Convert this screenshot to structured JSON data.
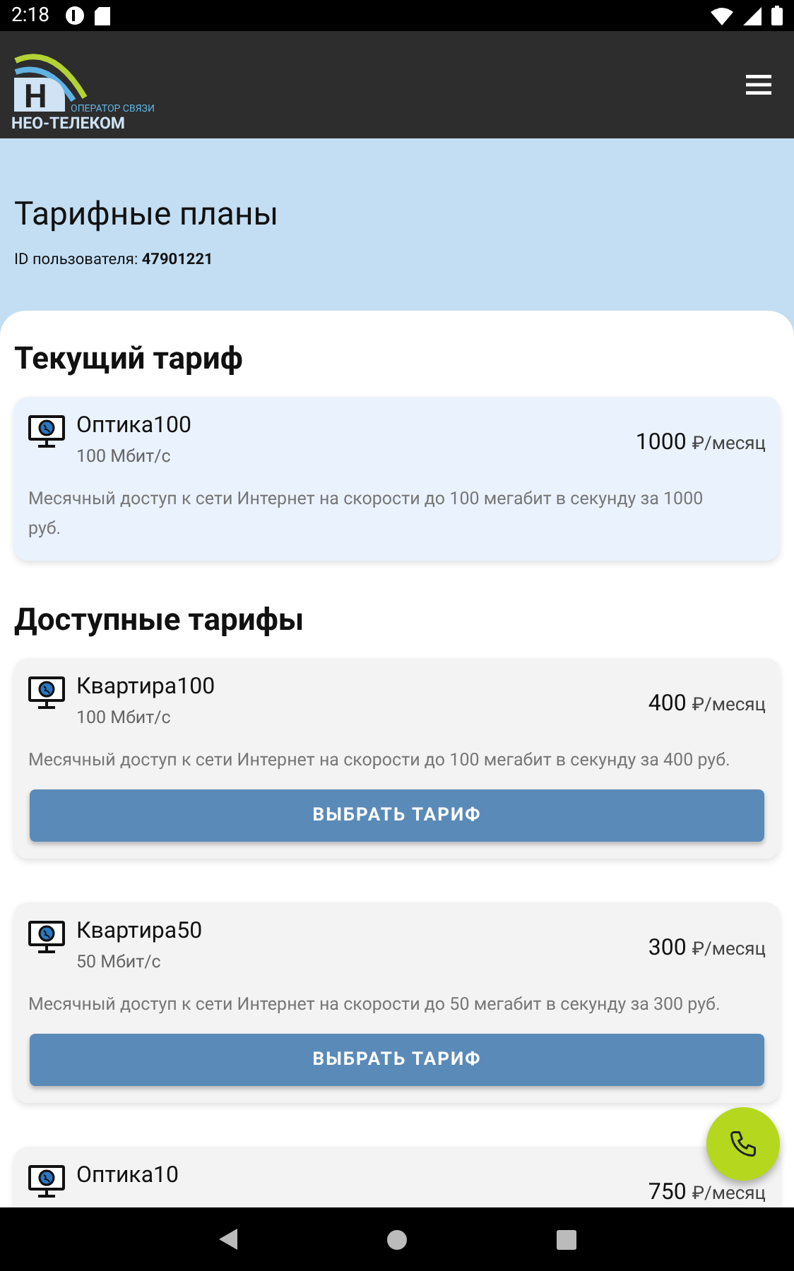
{
  "status_bar": {
    "time": "2:18"
  },
  "app_bar": {
    "logo": {
      "letter": "Н",
      "tagline": "ОПЕРАТОР СВЯЗИ",
      "name": "НЕО-ТЕЛЕКОМ"
    }
  },
  "header": {
    "title": "Тарифные планы",
    "user_id_label": "ID пользователя:",
    "user_id": "47901221"
  },
  "current": {
    "heading": "Текущий тариф",
    "plan": {
      "name": "Оптика100",
      "speed": "100 Мбит/с",
      "price": "1000",
      "unit": "₽/месяц",
      "description": "Месячный доступ к сети Интернет на скорости до 100 мегабит в секунду за 1000 руб."
    }
  },
  "available": {
    "heading": "Доступные тарифы",
    "plans": [
      {
        "name": "Квартира100",
        "speed": "100 Мбит/с",
        "price": "400",
        "unit": "₽/месяц",
        "description": "Месячный доступ к сети Интернет на скорости до 100 мегабит в секунду за 400 руб.",
        "button": "ВЫБРАТЬ ТАРИФ"
      },
      {
        "name": "Квартира50",
        "speed": "50 Мбит/с",
        "price": "300",
        "unit": "₽/месяц",
        "description": "Месячный доступ к сети Интернет на скорости до 50 мегабит в секунду за 300 руб.",
        "button": "ВЫБРАТЬ ТАРИФ"
      },
      {
        "name": "Оптика10",
        "price": "750",
        "unit": "₽/месяц"
      }
    ]
  }
}
